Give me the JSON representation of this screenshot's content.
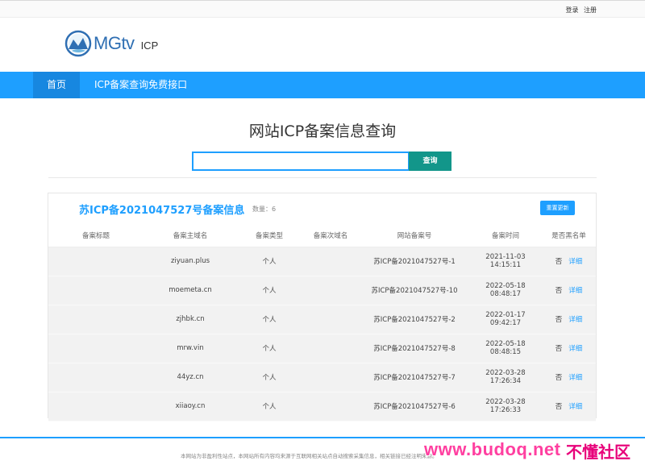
{
  "topbar": {
    "login": "登录",
    "register": "注册"
  },
  "logo": {
    "brand": "MGtv",
    "sub": "ICP"
  },
  "nav": {
    "home": "首页",
    "api": "ICP备案查询免费接口"
  },
  "page": {
    "title": "网站ICP备案信息查询"
  },
  "search": {
    "value": "",
    "placeholder": "",
    "button": "查询"
  },
  "panel": {
    "title": "苏ICP备2021047527号备案信息",
    "count": "数量：6",
    "refresh": "重置更新",
    "columns": [
      "备案标题",
      "备案主域名",
      "备案类型",
      "备案次域名",
      "网站备案号",
      "备案时间",
      "是否黑名单"
    ],
    "rows": [
      {
        "title": "",
        "domain": "ziyuan.plus",
        "type": "个人",
        "subdomain": "",
        "record": "苏ICP备2021047527号-1",
        "time": "2021-11-03 14:15:11",
        "blacklist": "否",
        "detail": "详细"
      },
      {
        "title": "",
        "domain": "moemeta.cn",
        "type": "个人",
        "subdomain": "",
        "record": "苏ICP备2021047527号-10",
        "time": "2022-05-18 08:48:17",
        "blacklist": "否",
        "detail": "详细"
      },
      {
        "title": "",
        "domain": "zjhbk.cn",
        "type": "个人",
        "subdomain": "",
        "record": "苏ICP备2021047527号-2",
        "time": "2022-01-17 09:42:17",
        "blacklist": "否",
        "detail": "详细"
      },
      {
        "title": "",
        "domain": "mrw.vin",
        "type": "个人",
        "subdomain": "",
        "record": "苏ICP备2021047527号-8",
        "time": "2022-05-18 08:48:15",
        "blacklist": "否",
        "detail": "详细"
      },
      {
        "title": "",
        "domain": "44yz.cn",
        "type": "个人",
        "subdomain": "",
        "record": "苏ICP备2021047527号-7",
        "time": "2022-03-28 17:26:34",
        "blacklist": "否",
        "detail": "详细"
      },
      {
        "title": "",
        "domain": "xiiaoy.cn",
        "type": "个人",
        "subdomain": "",
        "record": "苏ICP备2021047527号-6",
        "time": "2022-03-28 17:26:33",
        "blacklist": "否",
        "detail": "详细"
      }
    ]
  },
  "footer": {
    "text": "本网站为非盈利性站点，本网站所有内容均来源于互联网相关站点自动搜索采集信息，相关链接已经注明来源。"
  },
  "watermark": {
    "url": "www.budoq.net",
    "cn": "不懂社区"
  },
  "colors": {
    "accent": "#1e9fff",
    "nav_active": "#1787e0",
    "search_button": "#12968a",
    "watermark": "#ff3fa0"
  }
}
